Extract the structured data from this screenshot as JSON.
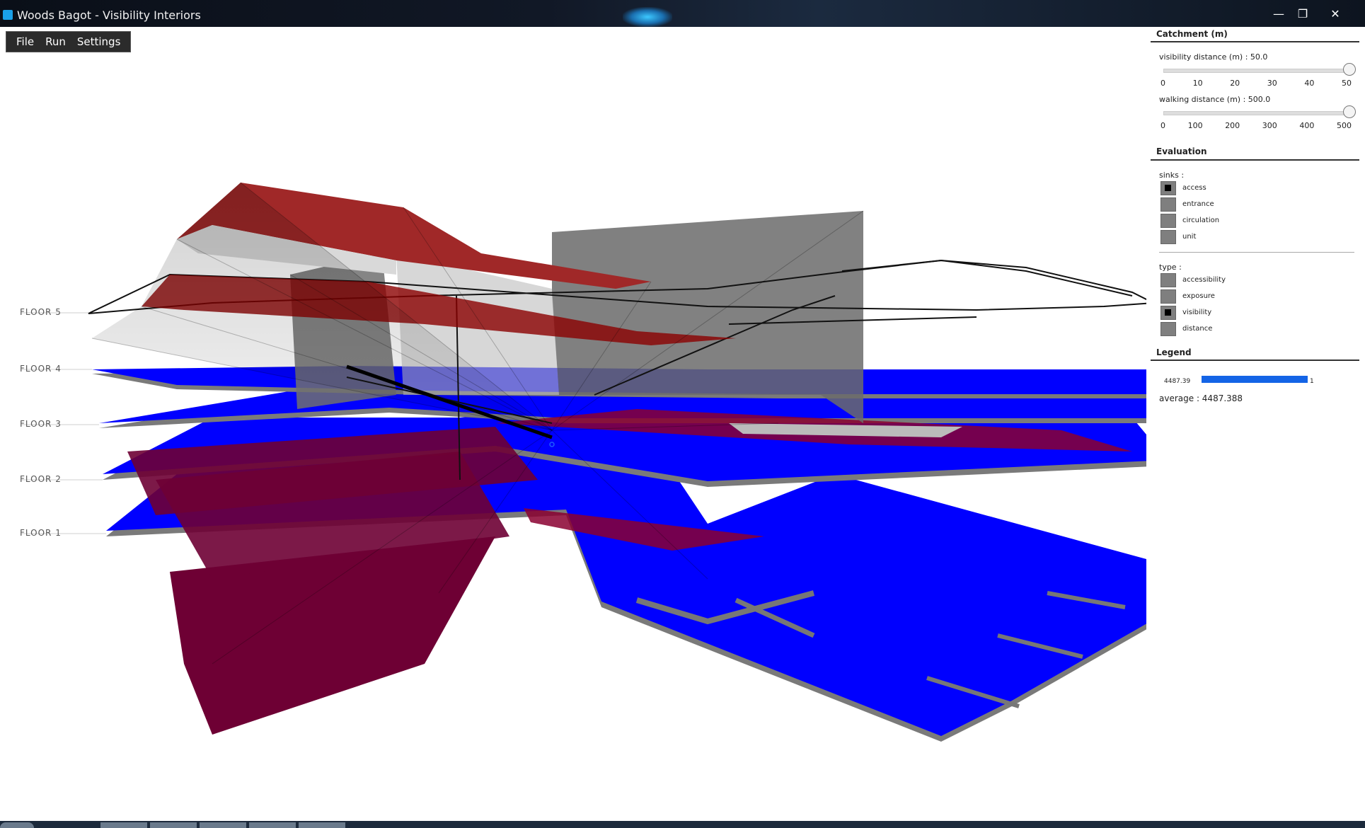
{
  "window": {
    "title": "Woods Bagot - Visibility Interiors",
    "minimize": "—",
    "restore": "❐",
    "close": "✕"
  },
  "menu": {
    "items": [
      "File",
      "Run",
      "Settings"
    ]
  },
  "viewport": {
    "floors": [
      "FLOOR 5",
      "FLOOR 4",
      "FLOOR 3",
      "FLOOR 2",
      "FLOOR 1"
    ]
  },
  "panel": {
    "catchment": {
      "title": "Catchment (m)",
      "visibility_label": "visibility distance (m) : 50.0",
      "visibility_value": 50.0,
      "visibility_max": 50,
      "visibility_ticks": [
        "0",
        "10",
        "20",
        "30",
        "40",
        "50"
      ],
      "walking_label": "walking distance (m) : 500.0",
      "walking_value": 500.0,
      "walking_max": 500,
      "walking_ticks": [
        "0",
        "100",
        "200",
        "300",
        "400",
        "500"
      ]
    },
    "evaluation": {
      "title": "Evaluation",
      "sinks_label": "sinks :",
      "sinks": [
        {
          "label": "access",
          "checked": true
        },
        {
          "label": "entrance",
          "checked": false
        },
        {
          "label": "circulation",
          "checked": false
        },
        {
          "label": "unit",
          "checked": false
        }
      ],
      "type_label": "type :",
      "types": [
        {
          "label": "accessibility",
          "checked": false
        },
        {
          "label": "exposure",
          "checked": false
        },
        {
          "label": "visibility",
          "checked": true
        },
        {
          "label": "distance",
          "checked": false
        }
      ]
    },
    "legend": {
      "title": "Legend",
      "min_value": "4487.39",
      "max_value": "1",
      "bar_color": "#1464e6",
      "average": "average : 4487.388"
    }
  },
  "colors": {
    "floor_blue": "#0000ff",
    "floor_red": "#7a0030",
    "core_gray": "#707070"
  }
}
